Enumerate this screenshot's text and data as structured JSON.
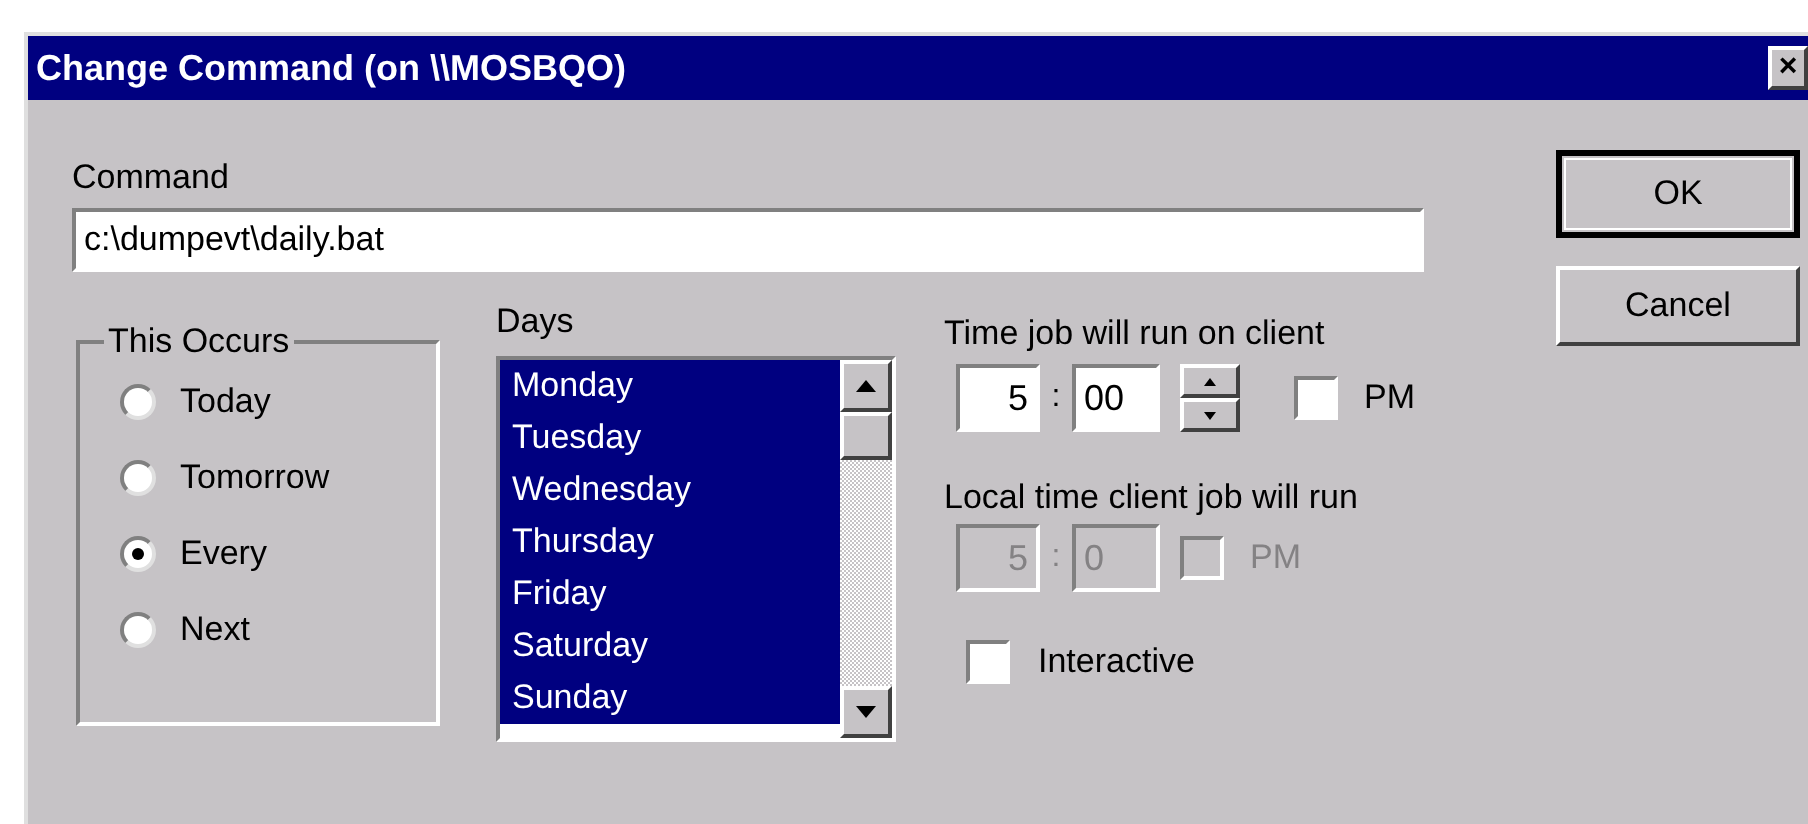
{
  "window": {
    "title": "Change Command (on \\\\MOSBQO)",
    "close": "×"
  },
  "command": {
    "label": "Command",
    "value": "c:\\dumpevt\\daily.bat"
  },
  "buttons": [
    "OK",
    "Cancel"
  ],
  "this_occurs": {
    "label": "This Occurs",
    "options": [
      {
        "label": "Today",
        "selected": false
      },
      {
        "label": "Tomorrow",
        "selected": false
      },
      {
        "label": "Every",
        "selected": true
      },
      {
        "label": "Next",
        "selected": false
      }
    ]
  },
  "days": {
    "label": "Days",
    "items": [
      {
        "label": "Monday",
        "selected": true
      },
      {
        "label": "Tuesday",
        "selected": true
      },
      {
        "label": "Wednesday",
        "selected": true
      },
      {
        "label": "Thursday",
        "selected": true
      },
      {
        "label": "Friday",
        "selected": true
      },
      {
        "label": "Saturday",
        "selected": true
      },
      {
        "label": "Sunday",
        "selected": true
      }
    ]
  },
  "client_time": {
    "label": "Time job will run on client",
    "hour": "5",
    "separator": ":",
    "minute": "00",
    "pm": {
      "label": "PM",
      "checked": false
    },
    "disabled": false
  },
  "local_time": {
    "label": "Local time client job will run",
    "hour": "5",
    "separator": ":",
    "minute": "0",
    "pm": {
      "label": "PM",
      "checked": false
    },
    "disabled": true
  },
  "interactive": {
    "label": "Interactive",
    "checked": false
  }
}
